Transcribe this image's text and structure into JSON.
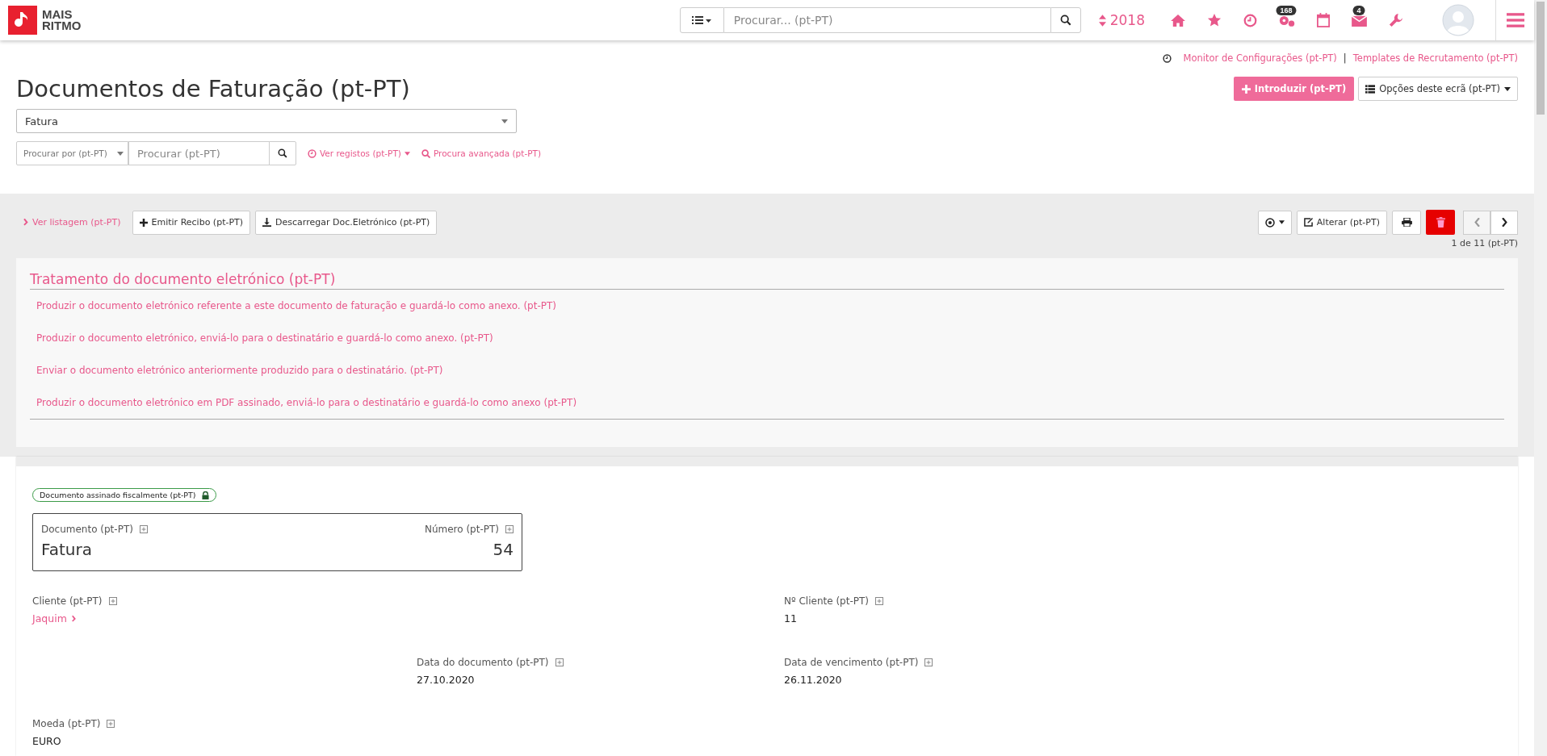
{
  "brand": {
    "line1": "MAIS",
    "line2": "RITMO"
  },
  "topbar": {
    "search_placeholder": "Procurar... (pt-PT)",
    "year": "2018",
    "nav_icons": [
      {
        "kind": "home"
      },
      {
        "kind": "star"
      },
      {
        "kind": "clock"
      },
      {
        "kind": "cogs",
        "badge": "168"
      },
      {
        "kind": "calendar"
      },
      {
        "kind": "mail",
        "badge": "4"
      },
      {
        "kind": "wrench"
      }
    ]
  },
  "header_links": [
    "Monitor de Configurações (pt-PT)",
    "Templates de Recrutamento (pt-PT)"
  ],
  "header_link_separator": "|",
  "page_title": "Documentos de Faturação (pt-PT)",
  "primary_button": "Introduzir (pt-PT)",
  "options_button": "Opções deste ecrã (pt-PT)",
  "type_select": {
    "value": "Fatura"
  },
  "search_by": {
    "placeholder": "Procurar por (pt-PT)"
  },
  "search": {
    "placeholder": "Procurar (pt-PT)"
  },
  "search_links": [
    "Ver registos (pt-PT)",
    "Procura avançada (pt-PT)"
  ],
  "toolbar": {
    "back_link": "Ver listagem (pt-PT)",
    "buttons": [
      {
        "label": "Emitir Recibo (pt-PT)",
        "kind": "plus"
      },
      {
        "label": "Descarregar Doc.Eletrónico (pt-PT)",
        "kind": "download"
      }
    ],
    "edit_button": "Alterar (pt-PT)",
    "prev_disabled": true,
    "next_disabled": false,
    "pager": "1 de 11 (pt-PT)"
  },
  "einvoice_panel": {
    "title": "Tratamento do documento eletrónico (pt-PT)",
    "actions": [
      "Produzir o documento eletrónico referente a este documento de faturação e guardá-lo como anexo. (pt-PT)",
      "Produzir o documento eletrónico, enviá-lo para o destinatário e guardá-lo como anexo. (pt-PT)",
      "Enviar o documento eletrónico anteriormente produzido para o destinatário. (pt-PT)",
      "Produzir o documento eletrónico em PDF assinado, enviá-lo para o destinatário e guardá-lo como anexo (pt-PT)"
    ]
  },
  "document": {
    "status_badge": "Documento assinado fiscalmente (pt-PT)",
    "doc_label": "Documento (pt-PT)",
    "doc_value": "Fatura",
    "number_label": "Número (pt-PT)",
    "number_value": "54",
    "rows": [
      [
        {
          "label": "Cliente (pt-PT)",
          "value": "Jaquim",
          "kind": "link"
        },
        null,
        {
          "label": "Nº Cliente (pt-PT)",
          "value": "11",
          "kind": "text"
        }
      ],
      [
        null,
        {
          "label": "Data do documento (pt-PT)",
          "value": "27.10.2020",
          "kind": "text"
        },
        {
          "label": "Data de vencimento (pt-PT)",
          "value": "26.11.2020",
          "kind": "text"
        }
      ],
      [
        {
          "label": "Moeda (pt-PT)",
          "value": "EURO",
          "kind": "text"
        },
        null,
        null
      ]
    ]
  }
}
